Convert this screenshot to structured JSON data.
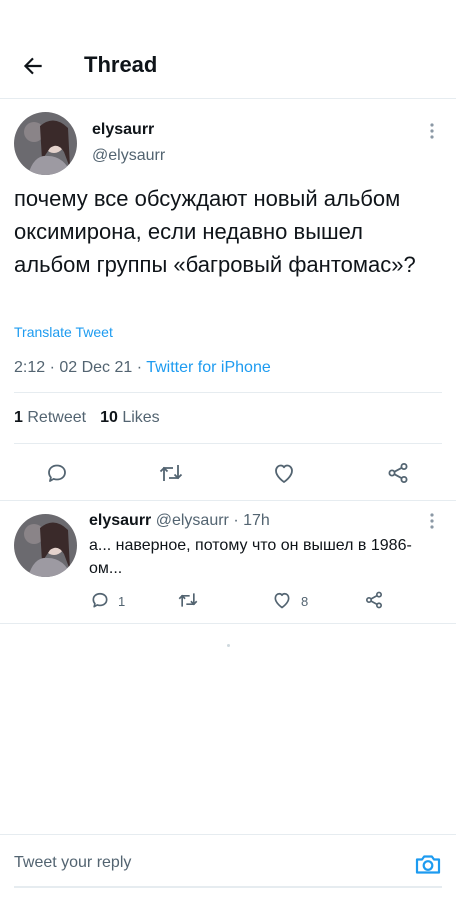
{
  "header": {
    "title": "Thread"
  },
  "main_tweet": {
    "name": "elysaurr",
    "handle": "@elysaurr",
    "text": "почему все обсуждают новый альбом оксимирона, если недавно вышел альбом группы «багровый фантомас»?",
    "translate": "Translate Tweet",
    "time": "2:12",
    "separator": " · ",
    "date": "02 Dec 21",
    "source": "Twitter for iPhone",
    "retweets_count": "1",
    "retweets_label": "Retweet",
    "likes_count": "10",
    "likes_label": "Likes"
  },
  "reply_tweet": {
    "name": "elysaurr",
    "handle": "@elysaurr",
    "time": "17h",
    "text": "а... наверное, потому что он вышел в 1986-ом...",
    "reply_count": "1",
    "like_count": "8"
  },
  "composer": {
    "placeholder": "Tweet your reply"
  },
  "colors": {
    "accent": "#1d9bf0",
    "text": "#0f1419",
    "muted": "#536471",
    "border": "#e6ecf0"
  },
  "icons": [
    "back-arrow-icon",
    "more-icon",
    "reply-icon",
    "retweet-icon",
    "like-icon",
    "share-icon",
    "camera-icon"
  ]
}
